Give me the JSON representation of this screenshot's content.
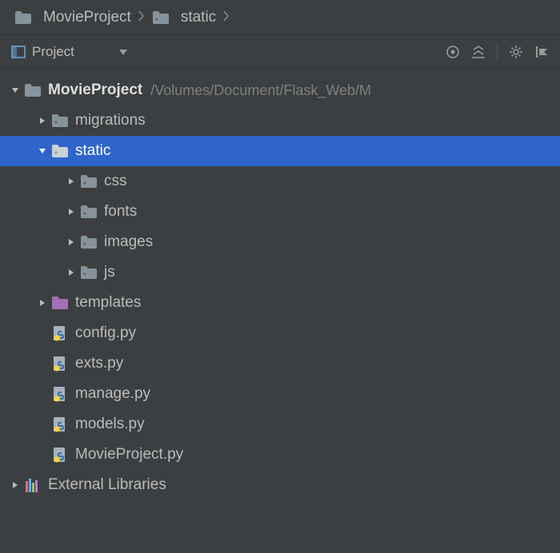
{
  "breadcrumb": {
    "items": [
      {
        "label": "MovieProject",
        "icon": "folder"
      },
      {
        "label": "static",
        "icon": "pkg-folder"
      }
    ]
  },
  "toolbar": {
    "view_label": "Project"
  },
  "tree": {
    "root": {
      "label": "MovieProject",
      "path": "/Volumes/Document/Flask_Web/M",
      "children": [
        {
          "label": "migrations",
          "icon": "pkg-folder",
          "expanded": false,
          "has_children": true
        },
        {
          "label": "static",
          "icon": "pkg-folder",
          "expanded": true,
          "has_children": true,
          "selected": true,
          "children": [
            {
              "label": "css",
              "icon": "pkg-folder",
              "expanded": false,
              "has_children": true
            },
            {
              "label": "fonts",
              "icon": "pkg-folder",
              "expanded": false,
              "has_children": true
            },
            {
              "label": "images",
              "icon": "pkg-folder",
              "expanded": false,
              "has_children": true
            },
            {
              "label": "js",
              "icon": "pkg-folder",
              "expanded": false,
              "has_children": true
            }
          ]
        },
        {
          "label": "templates",
          "icon": "purple-folder",
          "expanded": false,
          "has_children": true
        },
        {
          "label": "config.py",
          "icon": "python",
          "has_children": false
        },
        {
          "label": "exts.py",
          "icon": "python",
          "has_children": false
        },
        {
          "label": "manage.py",
          "icon": "python",
          "has_children": false
        },
        {
          "label": "models.py",
          "icon": "python",
          "has_children": false
        },
        {
          "label": "MovieProject.py",
          "icon": "python",
          "has_children": false
        }
      ]
    },
    "external_libraries": {
      "label": "External Libraries"
    }
  }
}
